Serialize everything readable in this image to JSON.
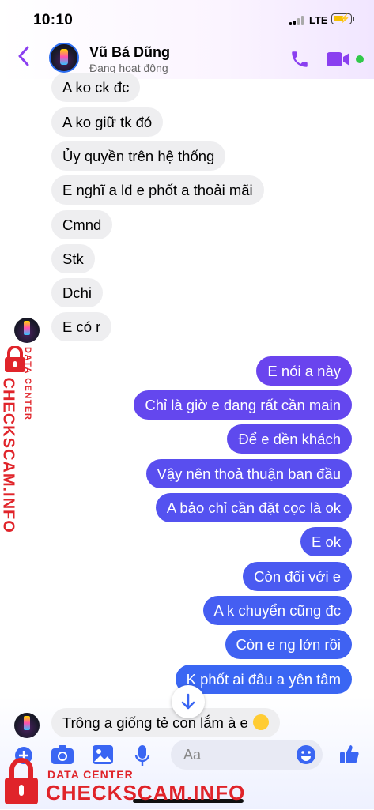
{
  "status_bar": {
    "time": "10:10",
    "network": "LTE"
  },
  "header": {
    "contact_name": "Vũ Bá Dũng",
    "contact_status": "Đang hoạt động"
  },
  "messages": [
    {
      "from": "them",
      "text": "A ko ck đc"
    },
    {
      "from": "them",
      "text": "A ko giữ tk đó"
    },
    {
      "from": "them",
      "text": "Ủy quyền trên hệ thống"
    },
    {
      "from": "them",
      "text": "E nghĩ a lđ e phốt a thoải mãi"
    },
    {
      "from": "them",
      "text": "Cmnd"
    },
    {
      "from": "them",
      "text": "Stk"
    },
    {
      "from": "them",
      "text": "Dchi"
    },
    {
      "from": "them",
      "text": "E có r"
    },
    {
      "from": "me",
      "text": "E nói a này"
    },
    {
      "from": "me",
      "text": "Chỉ là giờ e đang rất cần main"
    },
    {
      "from": "me",
      "text": "Để e đền khách"
    },
    {
      "from": "me",
      "text": "Vậy nên thoả thuận ban đầu"
    },
    {
      "from": "me",
      "text": "A bảo chỉ cần đặt cọc là ok"
    },
    {
      "from": "me",
      "text": "E ok"
    },
    {
      "from": "me",
      "text": "Còn đối với e"
    },
    {
      "from": "me",
      "text": "A k chuyển cũng đc"
    },
    {
      "from": "me",
      "text": "Còn e ng lớn rồi"
    },
    {
      "from": "me",
      "text": "K phốt ai đâu a yên tâm"
    },
    {
      "from": "them",
      "text": "Trông a giống tẻ con lắm à e",
      "emoji": "expressionless-face-emoji"
    }
  ],
  "composer": {
    "placeholder": "Aa"
  },
  "watermark": {
    "line1": "DATA CENTER",
    "line2": "CHECKSCAM.INFO"
  },
  "colors": {
    "accent": "#8a3ff0",
    "bubble_in": "#eeeef0",
    "bubble_out_top": "#6a3ff0",
    "bubble_out_bottom": "#3a6cf4",
    "watermark": "#e0242a"
  }
}
